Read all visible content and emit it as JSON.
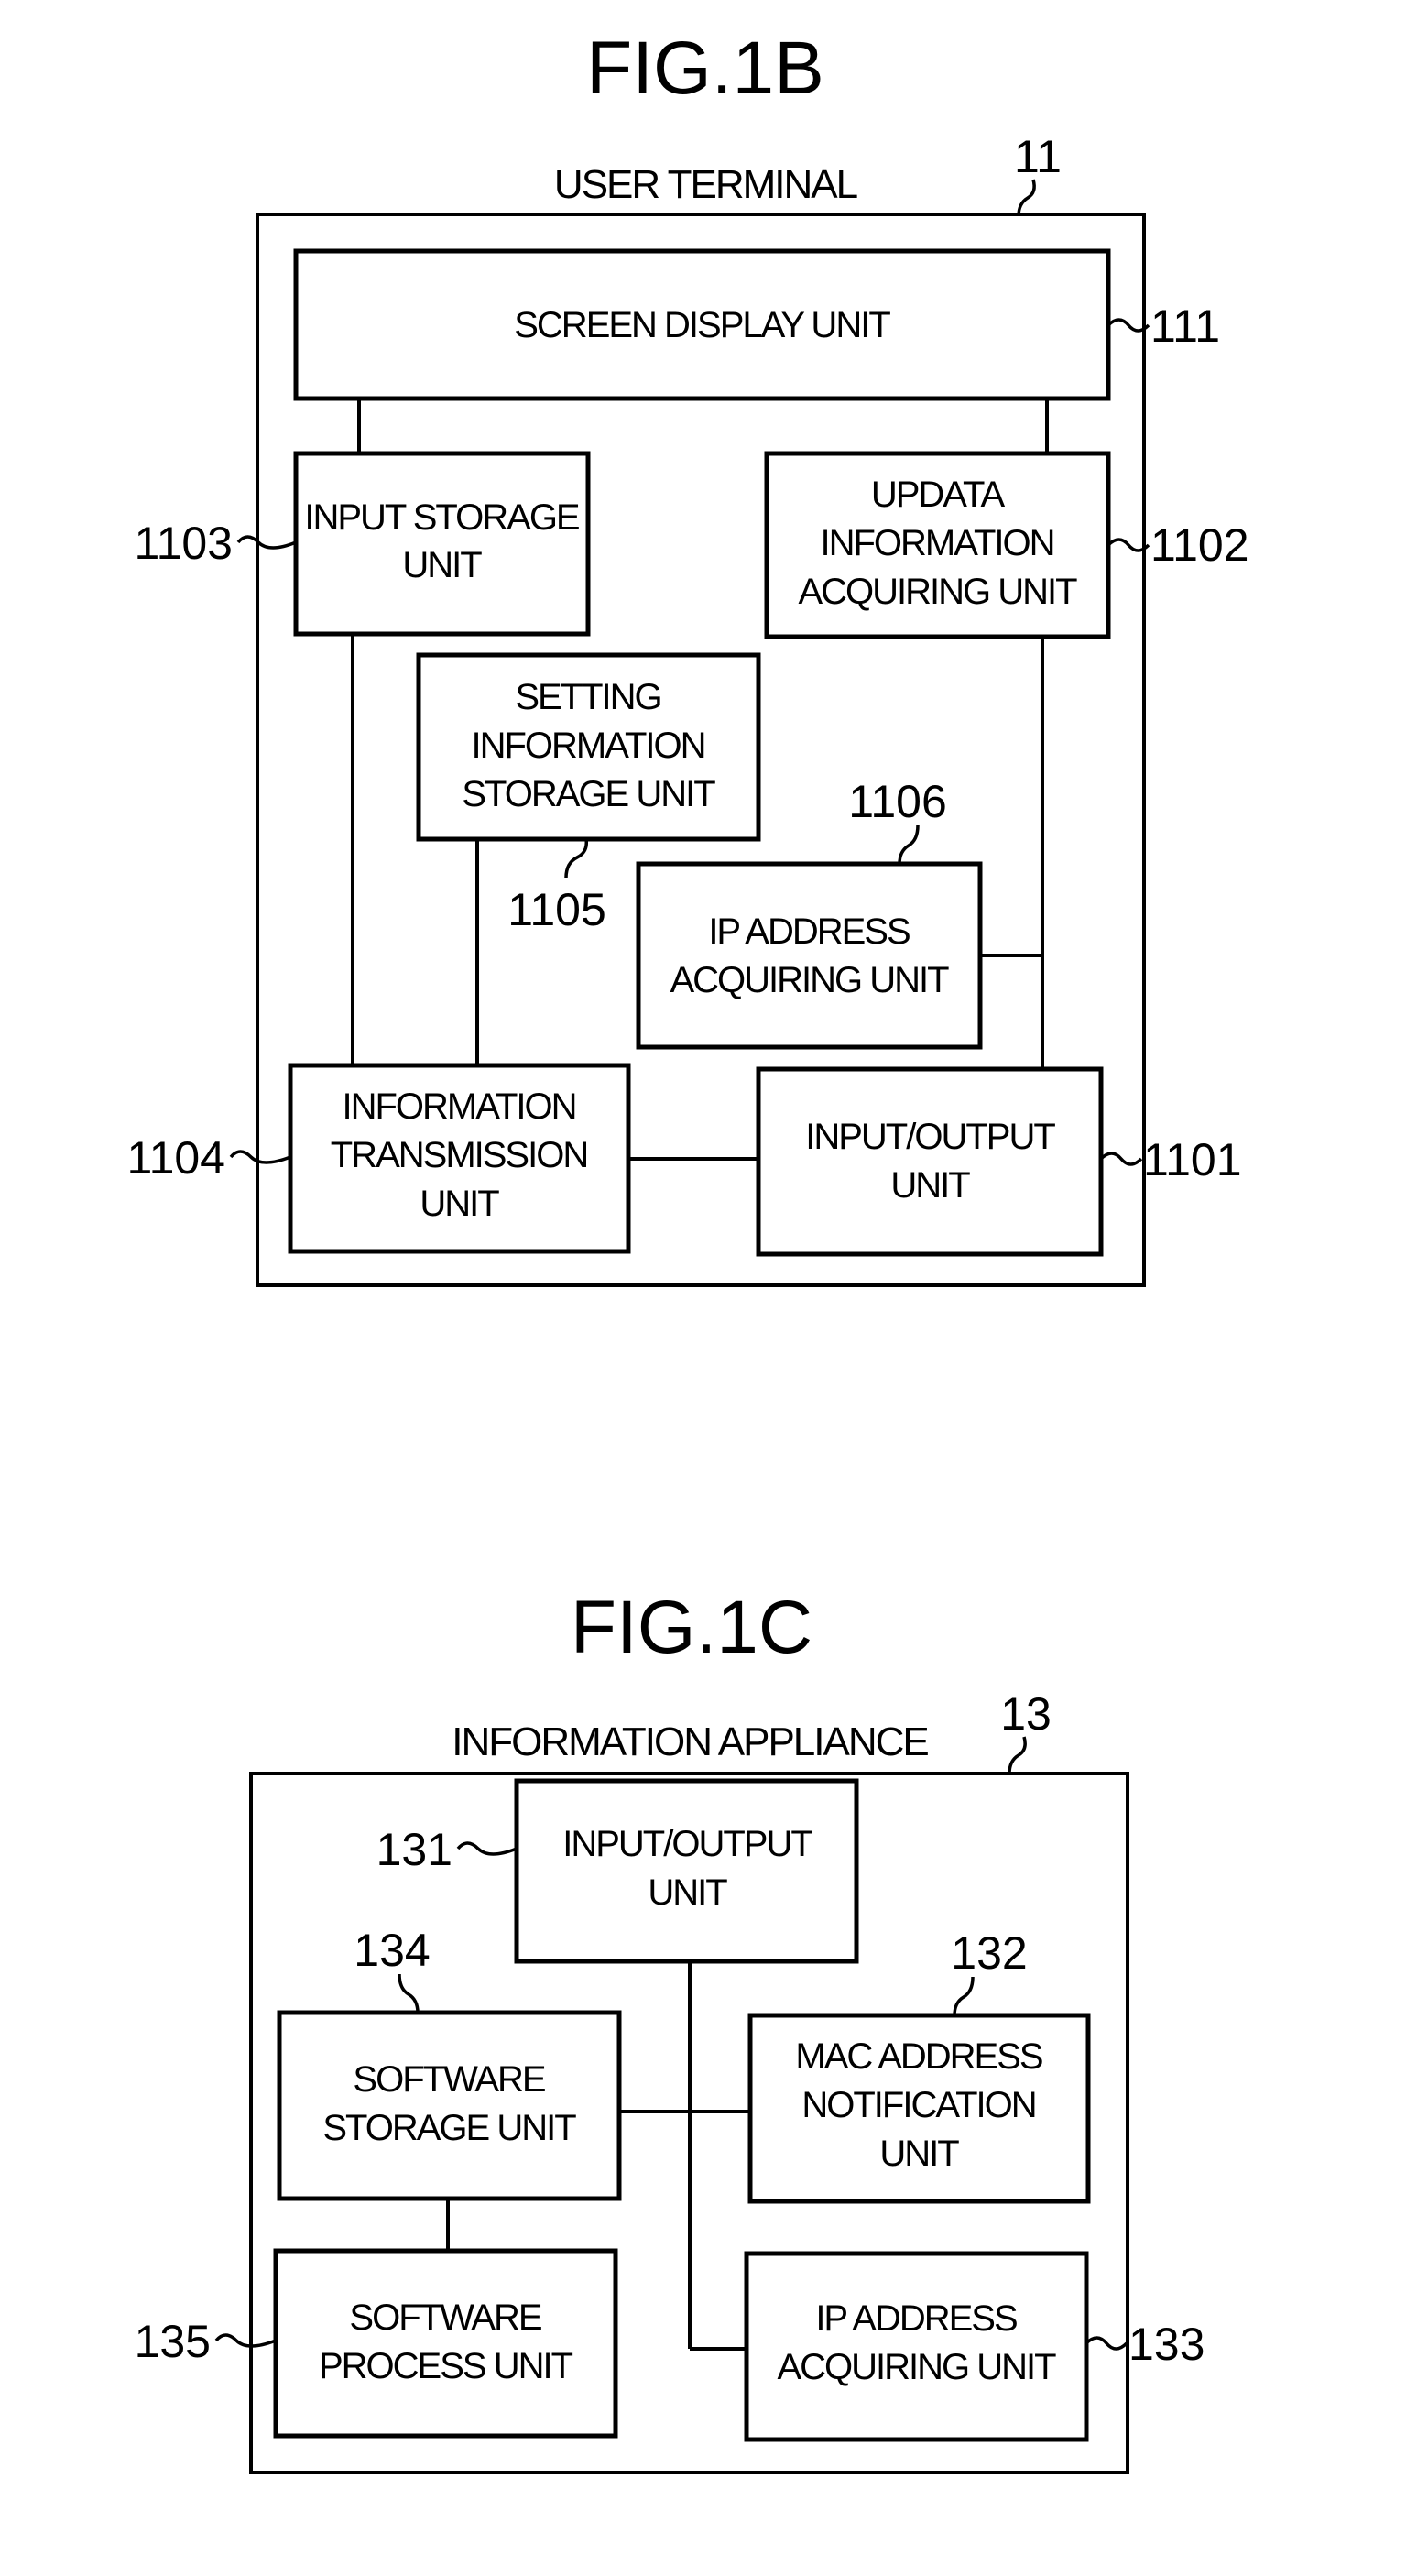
{
  "figures": [
    {
      "title": "FIG.1B",
      "group_label": "USER TERMINAL",
      "group_ref": "11",
      "units": [
        {
          "id": "screen-display",
          "ref": "111",
          "lines": [
            "SCREEN DISPLAY UNIT"
          ]
        },
        {
          "id": "input-storage",
          "ref": "1103",
          "lines": [
            "INPUT STORAGE",
            "UNIT"
          ]
        },
        {
          "id": "updata-info-acquiring",
          "ref": "1102",
          "lines": [
            "UPDATA",
            "INFORMATION",
            "ACQUIRING UNIT"
          ]
        },
        {
          "id": "setting-info-storage",
          "ref": "1105",
          "lines": [
            "SETTING",
            "INFORMATION",
            "STORAGE UNIT"
          ]
        },
        {
          "id": "ip-address-acquiring",
          "ref": "1106",
          "lines": [
            "IP ADDRESS",
            "ACQUIRING UNIT"
          ]
        },
        {
          "id": "info-transmission",
          "ref": "1104",
          "lines": [
            "INFORMATION",
            "TRANSMISSION",
            "UNIT"
          ]
        },
        {
          "id": "input-output",
          "ref": "1101",
          "lines": [
            "INPUT/OUTPUT",
            "UNIT"
          ]
        }
      ],
      "connections": [
        [
          "screen-display",
          "input-storage"
        ],
        [
          "screen-display",
          "updata-info-acquiring"
        ],
        [
          "input-storage",
          "info-transmission"
        ],
        [
          "setting-info-storage",
          "info-transmission"
        ],
        [
          "updata-info-acquiring",
          "input-output"
        ],
        [
          "ip-address-acquiring",
          "input-output"
        ],
        [
          "info-transmission",
          "input-output"
        ]
      ]
    },
    {
      "title": "FIG.1C",
      "group_label": "INFORMATION APPLIANCE",
      "group_ref": "13",
      "units": [
        {
          "id": "input-output",
          "ref": "131",
          "lines": [
            "INPUT/OUTPUT",
            "UNIT"
          ]
        },
        {
          "id": "software-storage",
          "ref": "134",
          "lines": [
            "SOFTWARE",
            "STORAGE UNIT"
          ]
        },
        {
          "id": "mac-address-notification",
          "ref": "132",
          "lines": [
            "MAC ADDRESS",
            "NOTIFICATION",
            "UNIT"
          ]
        },
        {
          "id": "software-process",
          "ref": "135",
          "lines": [
            "SOFTWARE",
            "PROCESS UNIT"
          ]
        },
        {
          "id": "ip-address-acquiring",
          "ref": "133",
          "lines": [
            "IP ADDRESS",
            "ACQUIRING UNIT"
          ]
        }
      ],
      "connections": [
        [
          "input-output",
          "software-storage"
        ],
        [
          "input-output",
          "mac-address-notification"
        ],
        [
          "input-output",
          "ip-address-acquiring"
        ],
        [
          "software-storage",
          "software-process"
        ]
      ]
    }
  ]
}
